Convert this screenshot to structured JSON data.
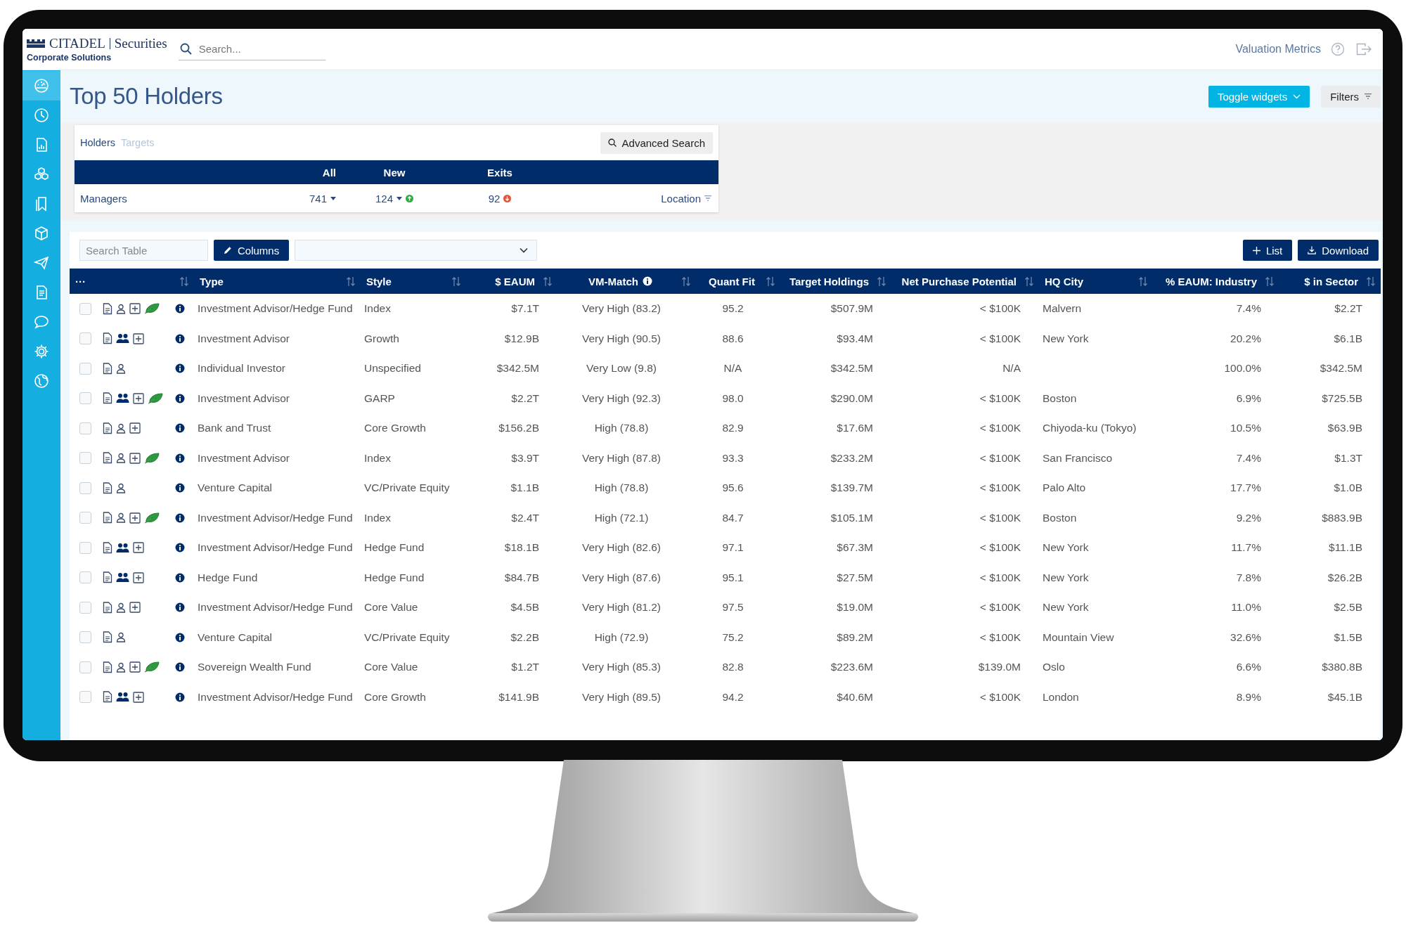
{
  "topbar": {
    "logo": {
      "name": "CITADEL",
      "division": "Securities",
      "subtitle": "Corporate Solutions"
    },
    "search": {
      "placeholder": "Search..."
    },
    "link": "Valuation Metrics"
  },
  "sidebar": {
    "items": [
      {
        "selected": true
      },
      {
        "selected": false
      },
      {
        "selected": false
      },
      {
        "selected": false
      },
      {
        "selected": false
      },
      {
        "selected": false
      },
      {
        "selected": false
      },
      {
        "selected": false
      },
      {
        "selected": false
      },
      {
        "selected": false
      },
      {
        "selected": false
      }
    ]
  },
  "page": {
    "title": "Top 50 Holders",
    "buttons": [
      {
        "label": "Toggle widgets",
        "kind": "primary"
      },
      {
        "label": "Filters",
        "kind": "filter"
      }
    ]
  },
  "widget": {
    "tabs": [
      {
        "label": "Holders",
        "selected": true
      },
      {
        "label": "Targets",
        "selected": false
      }
    ],
    "action": "Advanced Search",
    "columns": [
      "All",
      "New",
      "Exits"
    ],
    "row": {
      "label": "Managers",
      "cells": [
        {
          "value": "741",
          "caret": true,
          "badge": false,
          "increase": false
        },
        {
          "value": "124",
          "caret": true,
          "badge": true,
          "increase": true
        },
        {
          "value": "92",
          "caret": false,
          "badge": true,
          "increase": false
        }
      ],
      "location": "Location"
    }
  },
  "toolbar": {
    "search": {
      "placeholder": "Search Table"
    },
    "columns_button": "Columns",
    "list_button": "List",
    "download_button": "Download"
  },
  "table": {
    "columns": [
      {
        "label": "···"
      },
      {
        "label": "Type"
      },
      {
        "label": "Style"
      },
      {
        "label": "$ EAUM"
      },
      {
        "label": "VM-Match",
        "info_icon": true
      },
      {
        "label": "Quant Fit"
      },
      {
        "label": "Target Holdings"
      },
      {
        "label": "Net Purchase Potential"
      },
      {
        "label": "HQ City"
      },
      {
        "label": "% EAUM: Industry"
      },
      {
        "label": "$ in Sector"
      }
    ],
    "rows": [
      {
        "selected": false,
        "group_contact": false,
        "add": true,
        "esg": true,
        "type": "Investment Advisor/Hedge Fund",
        "style": "Index",
        "eaum": "$7.1T",
        "vm_match": "Very High (83.2)",
        "quant_fit": "95.2",
        "target_holdings": "$507.9M",
        "net_purchase_potential": "< $100K",
        "hq_city": "Malvern",
        "pct_eaum_industry": "7.4%",
        "in_sector": "$2.2T"
      },
      {
        "selected": false,
        "group_contact": true,
        "add": true,
        "esg": false,
        "type": "Investment Advisor",
        "style": "Growth",
        "eaum": "$12.9B",
        "vm_match": "Very High (90.5)",
        "quant_fit": "88.6",
        "target_holdings": "$93.4M",
        "net_purchase_potential": "< $100K",
        "hq_city": "New York",
        "pct_eaum_industry": "20.2%",
        "in_sector": "$6.1B"
      },
      {
        "selected": false,
        "group_contact": false,
        "add": false,
        "esg": false,
        "type": "Individual Investor",
        "style": "Unspecified",
        "eaum": "$342.5M",
        "vm_match": "Very Low (9.8)",
        "quant_fit": "N/A",
        "target_holdings": "$342.5M",
        "net_purchase_potential": "N/A",
        "pct_eaum_industry": "100.0%",
        "in_sector": "$342.5M"
      },
      {
        "selected": false,
        "group_contact": true,
        "add": true,
        "esg": true,
        "type": "Investment Advisor",
        "style": "GARP",
        "eaum": "$2.2T",
        "vm_match": "Very High (92.3)",
        "quant_fit": "98.0",
        "target_holdings": "$290.0M",
        "net_purchase_potential": "< $100K",
        "hq_city": "Boston",
        "pct_eaum_industry": "6.9%",
        "in_sector": "$725.5B"
      },
      {
        "selected": false,
        "group_contact": false,
        "add": true,
        "esg": false,
        "type": "Bank and Trust",
        "style": "Core Growth",
        "eaum": "$156.2B",
        "vm_match": "High (78.8)",
        "quant_fit": "82.9",
        "target_holdings": "$17.6M",
        "net_purchase_potential": "< $100K",
        "hq_city": "Chiyoda-ku (Tokyo)",
        "pct_eaum_industry": "10.5%",
        "in_sector": "$63.9B"
      },
      {
        "selected": false,
        "group_contact": false,
        "add": true,
        "esg": true,
        "type": "Investment Advisor",
        "style": "Index",
        "eaum": "$3.9T",
        "vm_match": "Very High (87.8)",
        "quant_fit": "93.3",
        "target_holdings": "$233.2M",
        "net_purchase_potential": "< $100K",
        "hq_city": "San Francisco",
        "pct_eaum_industry": "7.4%",
        "in_sector": "$1.3T"
      },
      {
        "selected": false,
        "group_contact": false,
        "add": false,
        "esg": false,
        "type": "Venture Capital",
        "style": "VC/Private Equity",
        "eaum": "$1.1B",
        "vm_match": "High (78.8)",
        "quant_fit": "95.6",
        "target_holdings": "$139.7M",
        "net_purchase_potential": "< $100K",
        "hq_city": "Palo Alto",
        "pct_eaum_industry": "17.7%",
        "in_sector": "$1.0B"
      },
      {
        "selected": false,
        "group_contact": false,
        "add": true,
        "esg": true,
        "type": "Investment Advisor/Hedge Fund",
        "style": "Index",
        "eaum": "$2.4T",
        "vm_match": "High (72.1)",
        "quant_fit": "84.7",
        "target_holdings": "$105.1M",
        "net_purchase_potential": "< $100K",
        "hq_city": "Boston",
        "pct_eaum_industry": "9.2%",
        "in_sector": "$883.9B"
      },
      {
        "selected": false,
        "group_contact": true,
        "add": true,
        "esg": false,
        "type": "Investment Advisor/Hedge Fund",
        "style": "Hedge Fund",
        "eaum": "$18.1B",
        "vm_match": "Very High (82.6)",
        "quant_fit": "97.1",
        "target_holdings": "$67.3M",
        "net_purchase_potential": "< $100K",
        "hq_city": "New York",
        "pct_eaum_industry": "11.7%",
        "in_sector": "$11.1B"
      },
      {
        "selected": false,
        "group_contact": true,
        "add": true,
        "esg": false,
        "type": "Hedge Fund",
        "style": "Hedge Fund",
        "eaum": "$84.7B",
        "vm_match": "Very High (87.6)",
        "quant_fit": "95.1",
        "target_holdings": "$27.5M",
        "net_purchase_potential": "< $100K",
        "hq_city": "New York",
        "pct_eaum_industry": "7.8%",
        "in_sector": "$26.2B"
      },
      {
        "selected": false,
        "group_contact": false,
        "add": true,
        "esg": false,
        "type": "Investment Advisor/Hedge Fund",
        "style": "Core Value",
        "eaum": "$4.5B",
        "vm_match": "Very High (81.2)",
        "quant_fit": "97.5",
        "target_holdings": "$19.0M",
        "net_purchase_potential": "< $100K",
        "hq_city": "New York",
        "pct_eaum_industry": "11.0%",
        "in_sector": "$2.5B"
      },
      {
        "selected": false,
        "group_contact": false,
        "add": false,
        "esg": false,
        "type": "Venture Capital",
        "style": "VC/Private Equity",
        "eaum": "$2.2B",
        "vm_match": "High (72.9)",
        "quant_fit": "75.2",
        "target_holdings": "$89.2M",
        "net_purchase_potential": "< $100K",
        "hq_city": "Mountain View",
        "pct_eaum_industry": "32.6%",
        "in_sector": "$1.5B"
      },
      {
        "selected": false,
        "group_contact": false,
        "add": true,
        "esg": true,
        "type": "Sovereign Wealth Fund",
        "style": "Core Value",
        "eaum": "$1.2T",
        "vm_match": "Very High (85.3)",
        "quant_fit": "82.8",
        "target_holdings": "$223.6M",
        "net_purchase_potential": "$139.0M",
        "hq_city": "Oslo",
        "pct_eaum_industry": "6.6%",
        "in_sector": "$380.8B"
      },
      {
        "selected": false,
        "group_contact": true,
        "add": true,
        "esg": false,
        "type": "Investment Advisor/Hedge Fund",
        "style": "Core Growth",
        "eaum": "$141.9B",
        "vm_match": "Very High (89.5)",
        "quant_fit": "94.2",
        "target_holdings": "$40.6M",
        "net_purchase_potential": "< $100K",
        "hq_city": "London",
        "pct_eaum_industry": "8.9%",
        "in_sector": "$45.1B"
      }
    ]
  }
}
